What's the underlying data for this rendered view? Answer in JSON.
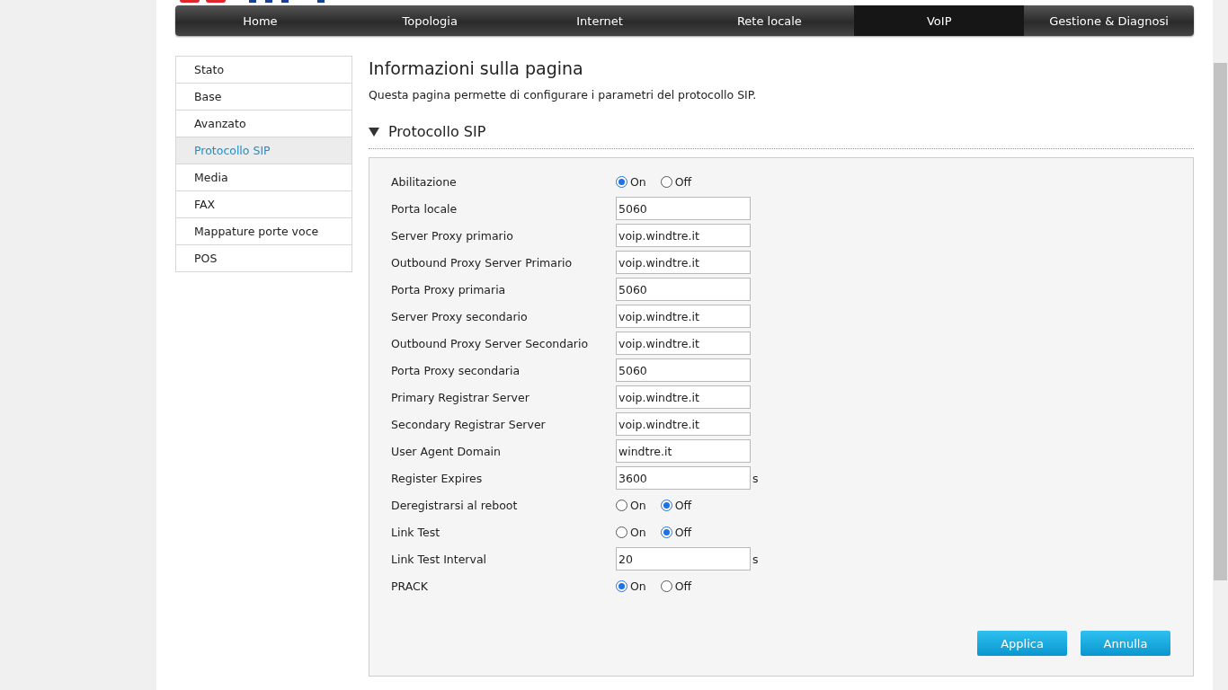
{
  "nav": [
    {
      "label": "Home",
      "selected": false
    },
    {
      "label": "Topologia",
      "selected": false
    },
    {
      "label": "Internet",
      "selected": false
    },
    {
      "label": "Rete locale",
      "selected": false
    },
    {
      "label": "VoIP",
      "selected": true
    },
    {
      "label": "Gestione & Diagnosi",
      "selected": false
    }
  ],
  "sidebar": [
    {
      "label": "Stato",
      "selected": false
    },
    {
      "label": "Base",
      "selected": false
    },
    {
      "label": "Avanzato",
      "selected": false
    },
    {
      "label": "Protocollo SIP",
      "selected": true
    },
    {
      "label": "Media",
      "selected": false
    },
    {
      "label": "FAX",
      "selected": false
    },
    {
      "label": "Mappature porte voce",
      "selected": false
    },
    {
      "label": "POS",
      "selected": false
    }
  ],
  "page_info": {
    "title": "Informazioni sulla pagina",
    "description": "Questa pagina permette di configurare i parametri del protocollo SIP."
  },
  "section": {
    "title": "Protocollo SIP",
    "expanded": true
  },
  "fields": [
    {
      "kind": "radio",
      "label": "Abilitazione",
      "options": [
        {
          "label": "On",
          "selected": true
        },
        {
          "label": "Off",
          "selected": false
        }
      ]
    },
    {
      "kind": "text",
      "label": "Porta locale",
      "value": "5060"
    },
    {
      "kind": "text",
      "label": "Server Proxy primario",
      "value": "voip.windtre.it"
    },
    {
      "kind": "text",
      "label": "Outbound Proxy Server Primario",
      "value": "voip.windtre.it"
    },
    {
      "kind": "text",
      "label": "Porta Proxy primaria",
      "value": "5060"
    },
    {
      "kind": "text",
      "label": "Server Proxy secondario",
      "value": "voip.windtre.it"
    },
    {
      "kind": "text",
      "label": "Outbound Proxy Server Secondario",
      "value": "voip.windtre.it"
    },
    {
      "kind": "text",
      "label": "Porta Proxy secondaria",
      "value": "5060"
    },
    {
      "kind": "text",
      "label": "Primary Registrar Server",
      "value": "voip.windtre.it"
    },
    {
      "kind": "text",
      "label": "Secondary Registrar Server",
      "value": "voip.windtre.it"
    },
    {
      "kind": "text",
      "label": "User Agent Domain",
      "value": "windtre.it"
    },
    {
      "kind": "text",
      "label": "Register Expires",
      "value": "3600",
      "unit": "s"
    },
    {
      "kind": "radio",
      "label": "Deregistrarsi al reboot",
      "options": [
        {
          "label": "On",
          "selected": false
        },
        {
          "label": "Off",
          "selected": true
        }
      ]
    },
    {
      "kind": "radio",
      "label": "Link Test",
      "options": [
        {
          "label": "On",
          "selected": false
        },
        {
          "label": "Off",
          "selected": true
        }
      ]
    },
    {
      "kind": "text",
      "label": "Link Test Interval",
      "value": "20",
      "unit": "s"
    },
    {
      "kind": "radio",
      "label": "PRACK",
      "options": [
        {
          "label": "On",
          "selected": true
        },
        {
          "label": "Off",
          "selected": false
        }
      ]
    }
  ],
  "buttons": [
    "Applica",
    "Annulla"
  ]
}
